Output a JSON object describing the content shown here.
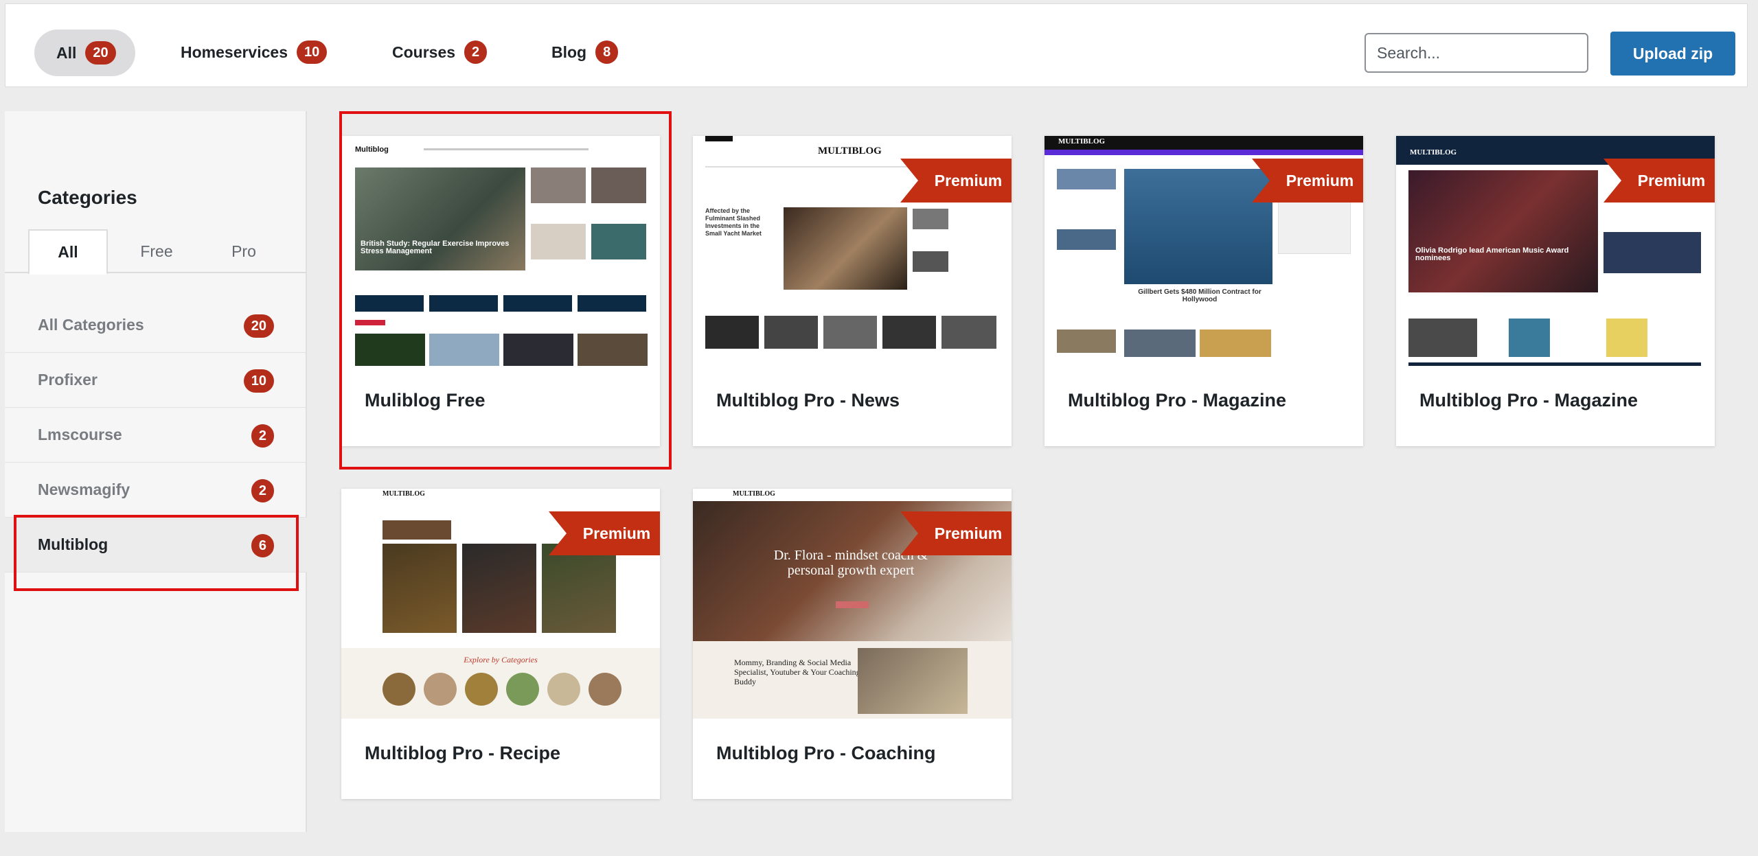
{
  "filters": [
    {
      "label": "All",
      "count": "20"
    },
    {
      "label": "Homeservices",
      "count": "10"
    },
    {
      "label": "Courses",
      "count": "2"
    },
    {
      "label": "Blog",
      "count": "8"
    }
  ],
  "search": {
    "placeholder": "Search..."
  },
  "upload": {
    "label": "Upload zip"
  },
  "sidebar": {
    "title": "Categories",
    "tabs": [
      "All",
      "Free",
      "Pro"
    ],
    "categories": [
      {
        "label": "All Categories",
        "count": "20"
      },
      {
        "label": "Profixer",
        "count": "10"
      },
      {
        "label": "Lmscourse",
        "count": "2"
      },
      {
        "label": "Newsmagify",
        "count": "2"
      },
      {
        "label": "Multiblog",
        "count": "6"
      }
    ]
  },
  "ribbon_label": "Premium",
  "cards": [
    {
      "name": "Muliblog Free",
      "premium": false
    },
    {
      "name": "Multiblog Pro - News",
      "premium": true
    },
    {
      "name": "Multiblog Pro - Magazine",
      "premium": true
    },
    {
      "name": "Multiblog Pro - Magazine",
      "premium": true
    },
    {
      "name": "Multiblog Pro - Recipe",
      "premium": true
    },
    {
      "name": "Multiblog Pro - Coaching",
      "premium": true
    }
  ],
  "thumbs": {
    "free": {
      "logo": "Multiblog",
      "headline": "British Study: Regular Exercise Improves Stress Management"
    },
    "news": {
      "logo": "MULTIBLOG",
      "headline": "Affected by the Fulminant Slashed Investments in the Small Yacht Market"
    },
    "magazine1": {
      "logo": "MULTIBLOG",
      "headline": "Gillbert Gets $480 Million Contract for Hollywood"
    },
    "magazine2": {
      "logo": "MULTIBLOG",
      "headline": "Olivia Rodrigo lead American Music Award nominees"
    },
    "recipe": {
      "logo": "MULTIBLOG",
      "section": "Explore by Categories"
    },
    "coaching": {
      "logo": "MULTIBLOG",
      "headline": "Dr. Flora - mindset coach & personal growth expert",
      "sub": "Mommy, Branding & Social Media Specialist, Youtuber & Your Coaching Buddy"
    }
  },
  "colors": {
    "accent": "#2271b1",
    "badge": "#b32d1a",
    "ribbon": "#c22f13",
    "highlight": "#e01010"
  }
}
